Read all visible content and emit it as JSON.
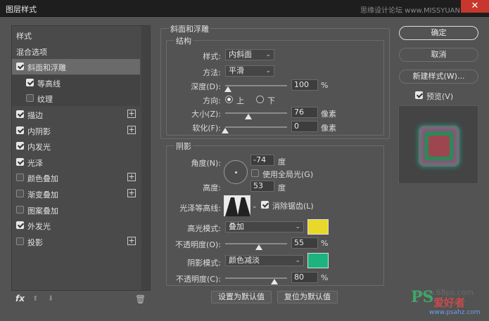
{
  "window": {
    "title": "图层样式",
    "watermark": "思缘设计论坛 www.MISSYUAN.COM",
    "close_label": "✕"
  },
  "styles_list": {
    "items": [
      {
        "label": "样式",
        "checkbox": false,
        "checked": false,
        "plus": false
      },
      {
        "label": "混合选项",
        "checkbox": false,
        "checked": false,
        "plus": false
      },
      {
        "label": "斜面和浮雕",
        "checkbox": true,
        "checked": true,
        "plus": false,
        "selected": true
      },
      {
        "label": "等高线",
        "checkbox": true,
        "checked": true,
        "plus": false,
        "sub": true
      },
      {
        "label": "纹理",
        "checkbox": true,
        "checked": false,
        "plus": false,
        "sub": true
      },
      {
        "label": "描边",
        "checkbox": true,
        "checked": true,
        "plus": true
      },
      {
        "label": "内阴影",
        "checkbox": true,
        "checked": true,
        "plus": true
      },
      {
        "label": "内发光",
        "checkbox": true,
        "checked": true,
        "plus": false
      },
      {
        "label": "光泽",
        "checkbox": true,
        "checked": true,
        "plus": false
      },
      {
        "label": "颜色叠加",
        "checkbox": true,
        "checked": false,
        "plus": true
      },
      {
        "label": "渐变叠加",
        "checkbox": true,
        "checked": false,
        "plus": true
      },
      {
        "label": "图案叠加",
        "checkbox": true,
        "checked": false,
        "plus": false
      },
      {
        "label": "外发光",
        "checkbox": true,
        "checked": true,
        "plus": false
      },
      {
        "label": "投影",
        "checkbox": true,
        "checked": false,
        "plus": true
      }
    ],
    "plus_glyph": "+",
    "fx_label": "fx",
    "up_glyph": "⬆",
    "down_glyph": "⬇",
    "trash_glyph": "🗑"
  },
  "bevel": {
    "group_title": "斜面和浮雕",
    "structure_title": "结构",
    "style_label": "样式:",
    "style_value": "内斜面",
    "technique_label": "方法:",
    "technique_value": "平滑",
    "depth_label": "深度(D):",
    "depth_value": "100",
    "depth_unit": "%",
    "depth_level": 0.05,
    "direction_label": "方向:",
    "direction_up": "上",
    "direction_down": "下",
    "direction_selected": "上",
    "size_label": "大小(Z):",
    "size_value": "76",
    "size_unit": "像素",
    "size_level": 0.38,
    "soften_label": "软化(F):",
    "soften_value": "0",
    "soften_unit": "像素",
    "soften_level": 0.0
  },
  "shading": {
    "title": "阴影",
    "angle_label": "角度(N):",
    "angle_value": "-74",
    "angle_unit": "度",
    "global_light_label": "使用全局光(G)",
    "global_light_checked": false,
    "altitude_label": "高度:",
    "altitude_value": "53",
    "altitude_unit": "度",
    "gloss_contour_label": "光泽等高线:",
    "antialias_label": "消除锯齿(L)",
    "antialias_checked": true,
    "highlight_mode_label": "高光模式:",
    "highlight_mode_value": "叠加",
    "highlight_color": "#e8d82a",
    "highlight_opacity_label": "不透明度(O):",
    "highlight_opacity_value": "55",
    "highlight_opacity_unit": "%",
    "highlight_opacity_level": 0.55,
    "shadow_mode_label": "阴影模式:",
    "shadow_mode_value": "颜色减淡",
    "shadow_color": "#1db37f",
    "shadow_opacity_label": "不透明度(C):",
    "shadow_opacity_value": "80",
    "shadow_opacity_unit": "%",
    "shadow_opacity_level": 0.8
  },
  "bottom_buttons": {
    "make_default": "设置为默认值",
    "reset_default": "复位为默认值"
  },
  "right_buttons": {
    "ok": "确定",
    "cancel": "取消",
    "new_style": "新建样式(W)...",
    "preview_label": "预览(V)",
    "preview_checked": true
  },
  "branding": {
    "logo": "PS",
    "logo_sub": "爱好者",
    "logo_url": "www.psahz.com",
    "mid_watermark": "www.68ps.com"
  }
}
